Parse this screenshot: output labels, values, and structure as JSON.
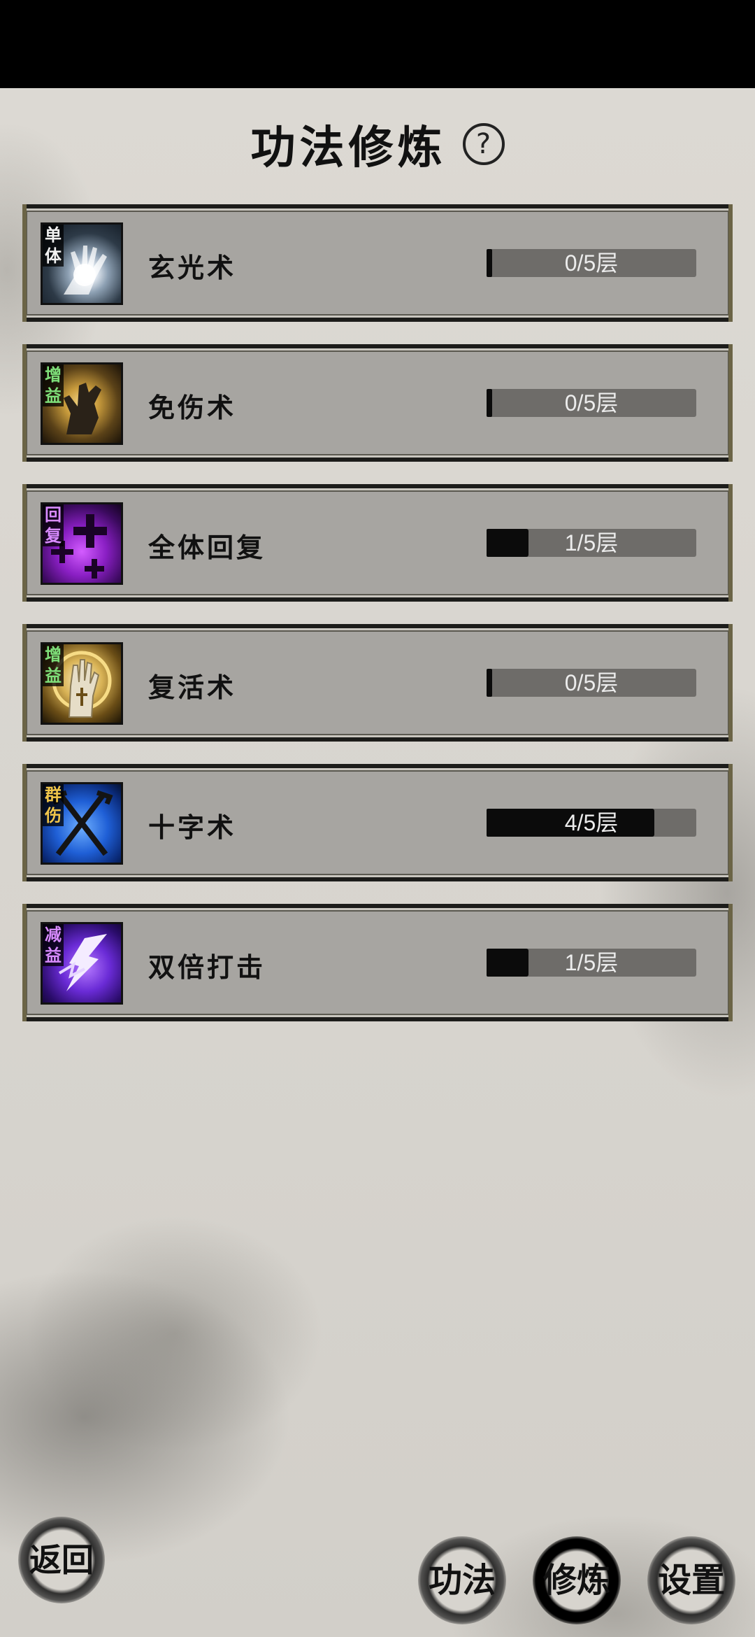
{
  "header": {
    "title": "功法修炼"
  },
  "skills": [
    {
      "tag": "单体",
      "tag_color": "#f2f2f2",
      "name": "玄光术",
      "level": 0,
      "max": 5,
      "label": "0/5层",
      "icon": "glowing-hand-icon"
    },
    {
      "tag": "增益",
      "tag_color": "#7fe07a",
      "name": "免伤术",
      "level": 0,
      "max": 5,
      "label": "0/5层",
      "icon": "shadow-hand-icon"
    },
    {
      "tag": "回复",
      "tag_color": "#d88bff",
      "name": "全体回复",
      "level": 1,
      "max": 5,
      "label": "1/5层",
      "icon": "purple-crosses-icon"
    },
    {
      "tag": "增益",
      "tag_color": "#7fe07a",
      "name": "复活术",
      "level": 0,
      "max": 5,
      "label": "0/5层",
      "icon": "holy-hand-icon"
    },
    {
      "tag": "群伤",
      "tag_color": "#f0c54a",
      "name": "十字术",
      "level": 4,
      "max": 5,
      "label": "4/5层",
      "icon": "crossed-staves-icon"
    },
    {
      "tag": "减益",
      "tag_color": "#d88bff",
      "name": "双倍打击",
      "level": 1,
      "max": 5,
      "label": "1/5层",
      "icon": "lightning-bolt-icon"
    }
  ],
  "nav": {
    "back": "返回",
    "gongfa": "功法",
    "xiulian": "修炼",
    "shezhi": "设置",
    "active": "xiulian"
  }
}
